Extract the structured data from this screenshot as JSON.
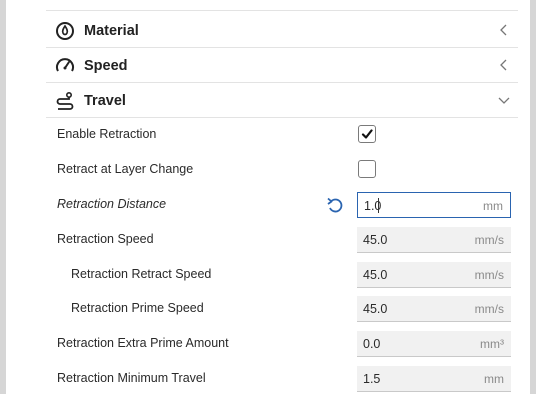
{
  "sections": {
    "material": {
      "title": "Material",
      "icon": "material-icon",
      "state": "collapsed"
    },
    "speed": {
      "title": "Speed",
      "icon": "speedometer-icon",
      "state": "collapsed"
    },
    "travel": {
      "title": "Travel",
      "icon": "travel-icon",
      "state": "expanded"
    }
  },
  "settings": {
    "enable_retraction": {
      "label": "Enable Retraction",
      "checked": true
    },
    "retract_at_layer_change": {
      "label": "Retract at Layer Change",
      "checked": false
    },
    "retraction_distance": {
      "label": "Retraction Distance",
      "value": "1.0",
      "unit": "mm"
    },
    "retraction_speed": {
      "label": "Retraction Speed",
      "value": "45.0",
      "unit": "mm/s"
    },
    "retraction_retract_speed": {
      "label": "Retraction Retract Speed",
      "value": "45.0",
      "unit": "mm/s"
    },
    "retraction_prime_speed": {
      "label": "Retraction Prime Speed",
      "value": "45.0",
      "unit": "mm/s"
    },
    "retraction_extra_prime_amount": {
      "label": "Retraction Extra Prime Amount",
      "value": "0.0",
      "unit": "mm³"
    },
    "retraction_minimum_travel": {
      "label": "Retraction Minimum Travel",
      "value": "1.5",
      "unit": "mm"
    }
  },
  "colors": {
    "accent": "#2a64b0",
    "field_bg": "#f1f1f1",
    "text": "#2a2a2a",
    "unit": "#8a8a8a"
  }
}
